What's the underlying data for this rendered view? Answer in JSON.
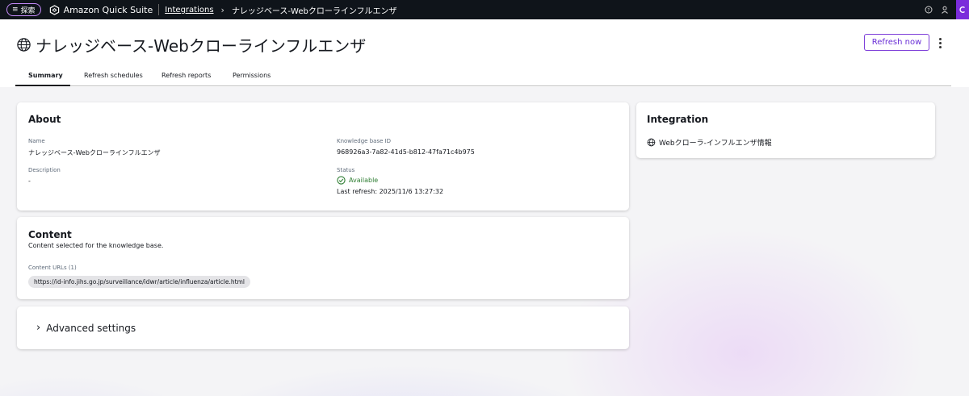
{
  "topbar": {
    "menu_label": "探索",
    "app_name": "Amazon Quick Suite",
    "breadcrumb_link": "Integrations",
    "breadcrumb_current": "ナレッジベース-Webクローラインフルエンザ"
  },
  "header": {
    "title": "ナレッジベース-Webクローラインフルエンザ",
    "refresh_label": "Refresh now",
    "tabs": [
      {
        "label": "Summary"
      },
      {
        "label": "Refresh schedules"
      },
      {
        "label": "Refresh reports"
      },
      {
        "label": "Permissions"
      }
    ]
  },
  "about": {
    "title": "About",
    "name_label": "Name",
    "name_value": "ナレッジベース-Webクローラインフルエンザ",
    "description_label": "Description",
    "description_value": "-",
    "kb_id_label": "Knowledge base ID",
    "kb_id_value": "968926a3-7a82-41d5-b812-47fa71c4b975",
    "status_label": "Status",
    "status_value": "Available",
    "last_refresh": "Last refresh: 2025/11/6 13:27:32"
  },
  "content": {
    "title": "Content",
    "subtitle": "Content selected for the knowledge base.",
    "urls_label": "Content URLs (1)",
    "urls": [
      "https://id-info.jihs.go.jp/surveillance/idwr/article/influenza/article.html"
    ]
  },
  "advanced": {
    "title": "Advanced settings"
  },
  "integration": {
    "title": "Integration",
    "item_label": "Webクローラ-インフルエンザ情報"
  },
  "colors": {
    "accent": "#7e3fd9",
    "status_ok": "#2e7d32",
    "topbar_bg": "#0f141a"
  }
}
